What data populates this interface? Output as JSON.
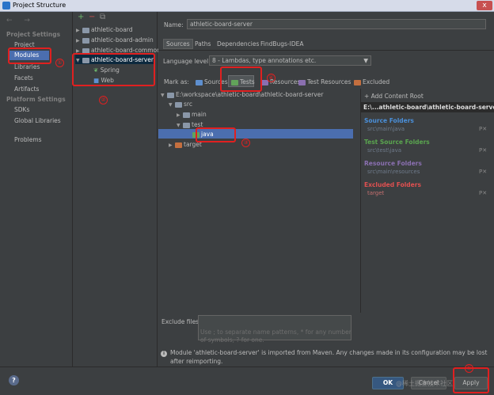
{
  "window": {
    "title": "Project Structure",
    "close": "x"
  },
  "nav": {
    "project_settings_header": "Project Settings",
    "project_settings": [
      "Project",
      "Modules",
      "Libraries",
      "Facets",
      "Artifacts"
    ],
    "platform_settings_header": "Platform Settings",
    "platform_settings": [
      "SDKs",
      "Global Libraries"
    ],
    "problems": "Problems"
  },
  "modules_tree": {
    "toolbar": [
      "+",
      "−",
      "⧉"
    ],
    "items": [
      "athletic-board",
      "athletic-board-admin",
      "athletic-board-common",
      "athletic-board-server"
    ],
    "children": [
      "Spring",
      "Web"
    ]
  },
  "module": {
    "name_label": "Name:",
    "name_value": "athletic-board-server",
    "tabs": [
      "Sources",
      "Paths",
      "Dependencies",
      "FindBugs-IDEA"
    ],
    "language_label": "Language level:",
    "language_value": "8 - Lambdas, type annotations etc.",
    "mark_as_label": "Mark as:",
    "mark_as": [
      "Sources",
      "Tests",
      "Resources",
      "Test Resources",
      "Excluded"
    ]
  },
  "content_tree": {
    "root": "E:\\workspace\\athletic-board\\athletic-board-server",
    "nodes": [
      "src",
      "main",
      "test",
      "java",
      "target"
    ]
  },
  "content_root": {
    "add_label": "+ Add Content Root",
    "path": "E:\\...athletic-board\\athletic-board-server",
    "source_header": "Source Folders",
    "source_value": "src\\main\\java",
    "test_header": "Test Source Folders",
    "test_value": "src\\test\\java",
    "resource_header": "Resource Folders",
    "resource_value": "src\\main\\resources",
    "excluded_header": "Excluded Folders",
    "excluded_value": "target",
    "row_actions": "P✕",
    "colors": {
      "source": "#4a8fd9",
      "test": "#5aa44f",
      "resource": "#8a6fb0",
      "excluded": "#e05050"
    }
  },
  "exclude": {
    "label": "Exclude files:",
    "hint": "Use ; to separate name patterns, * for any number of symbols, ? for one."
  },
  "info": {
    "icon": "i",
    "message": "Module 'athletic-board-server' is imported from Maven. Any changes made in its configuration may be lost after reimporting."
  },
  "buttons": {
    "help": "?",
    "ok": "OK",
    "cancel": "Cancel",
    "apply": "Apply"
  },
  "annotations": [
    "①",
    "②",
    "③",
    "④",
    "⑤"
  ],
  "watermark": "@稀土掘金技术社区"
}
